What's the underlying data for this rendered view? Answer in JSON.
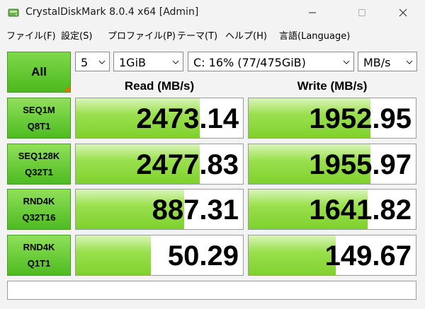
{
  "window": {
    "title": "CrystalDiskMark 8.0.4 x64 [Admin]"
  },
  "menu": [
    "ファイル(F)",
    "設定(S)",
    "プロファイル(P)",
    "テーマ(T)",
    "ヘルプ(H)",
    "言語(Language)"
  ],
  "controls": {
    "all_label": "All",
    "count": "5",
    "size": "1GiB",
    "drive": "C: 16% (77/475GiB)",
    "unit": "MB/s"
  },
  "headers": {
    "read": "Read (MB/s)",
    "write": "Write (MB/s)"
  },
  "rows": [
    {
      "line1": "SEQ1M",
      "line2": "Q8T1",
      "read": "2473.14",
      "write": "1952.95",
      "read_fill": 0.74,
      "write_fill": 0.73
    },
    {
      "line1": "SEQ128K",
      "line2": "Q32T1",
      "read": "2477.83",
      "write": "1955.97",
      "read_fill": 0.74,
      "write_fill": 0.73
    },
    {
      "line1": "RND4K",
      "line2": "Q32T16",
      "read": "887.31",
      "write": "1641.82",
      "read_fill": 0.65,
      "write_fill": 0.71
    },
    {
      "line1": "RND4K",
      "line2": "Q1T1",
      "read": "50.29",
      "write": "149.67",
      "read_fill": 0.45,
      "write_fill": 0.52
    }
  ],
  "colors": {
    "accent_green": "#4cb81c",
    "bar_green": "#7fd12d",
    "corner_orange": "#f06a00"
  },
  "icons": {
    "app": "disk-icon",
    "minimize": "minimize-icon",
    "maximize": "maximize-icon",
    "close": "close-icon",
    "dropdown": "chevron-down-icon"
  }
}
